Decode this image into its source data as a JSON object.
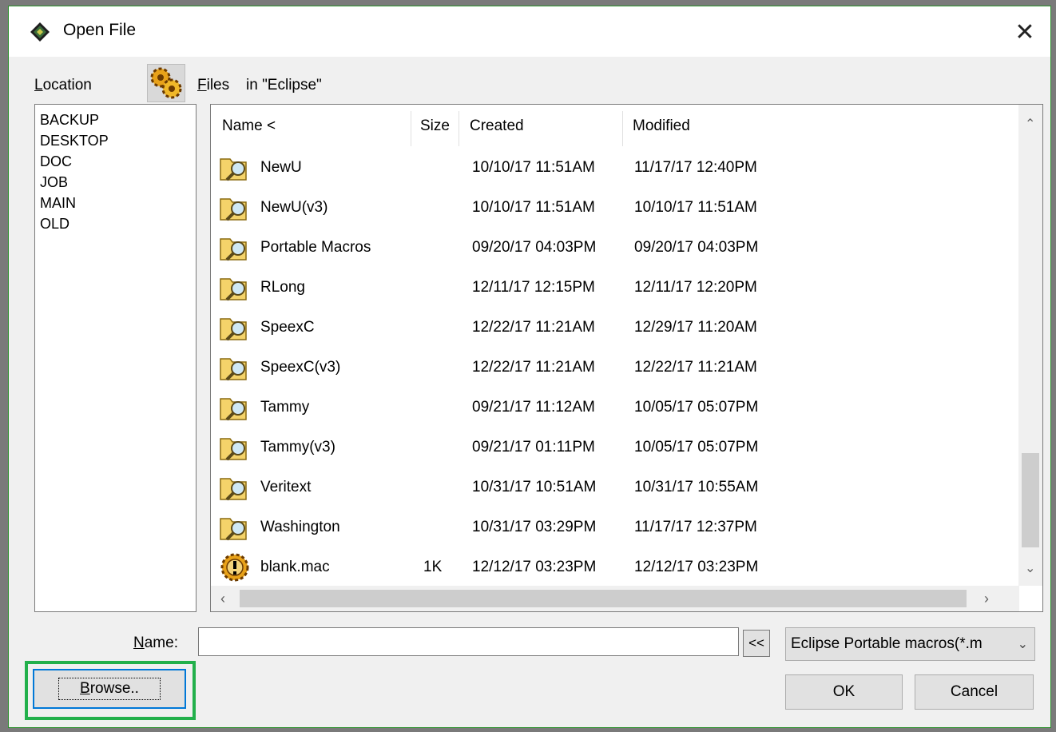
{
  "dialog": {
    "title": "Open File",
    "close_glyph": "✕"
  },
  "location": {
    "label": "Location",
    "items": [
      "BACKUP",
      "DESKTOP",
      "DOC",
      "JOB",
      "MAIN",
      "OLD"
    ]
  },
  "files": {
    "label": "Files",
    "context": "in \"Eclipse\"",
    "columns": [
      "Name <",
      "Size",
      "Created",
      "Modified"
    ],
    "rows": [
      {
        "name": "NewU",
        "size": "",
        "created": "10/10/17 11:51AM",
        "modified": "11/17/17 12:40PM",
        "icon": "folder-search-icon"
      },
      {
        "name": "NewU(v3)",
        "size": "",
        "created": "10/10/17 11:51AM",
        "modified": "10/10/17 11:51AM",
        "icon": "folder-search-icon"
      },
      {
        "name": "Portable Macros",
        "size": "",
        "created": "09/20/17 04:03PM",
        "modified": "09/20/17 04:03PM",
        "icon": "folder-search-icon"
      },
      {
        "name": "RLong",
        "size": "",
        "created": "12/11/17 12:15PM",
        "modified": "12/11/17 12:20PM",
        "icon": "folder-search-icon"
      },
      {
        "name": "SpeexC",
        "size": "",
        "created": "12/22/17 11:21AM",
        "modified": "12/29/17 11:20AM",
        "icon": "folder-search-icon"
      },
      {
        "name": "SpeexC(v3)",
        "size": "",
        "created": "12/22/17 11:21AM",
        "modified": "12/22/17 11:21AM",
        "icon": "folder-search-icon"
      },
      {
        "name": "Tammy",
        "size": "",
        "created": "09/21/17 11:12AM",
        "modified": "10/05/17 05:07PM",
        "icon": "folder-search-icon"
      },
      {
        "name": "Tammy(v3)",
        "size": "",
        "created": "09/21/17 01:11PM",
        "modified": "10/05/17 05:07PM",
        "icon": "folder-search-icon"
      },
      {
        "name": "Veritext",
        "size": "",
        "created": "10/31/17 10:51AM",
        "modified": "10/31/17 10:55AM",
        "icon": "folder-search-icon"
      },
      {
        "name": "Washington",
        "size": "",
        "created": "10/31/17 03:29PM",
        "modified": "11/17/17 12:37PM",
        "icon": "folder-search-icon"
      },
      {
        "name": "blank.mac",
        "size": "1K",
        "created": "12/12/17 03:23PM",
        "modified": "12/12/17 03:23PM",
        "icon": "macro-file-icon"
      }
    ]
  },
  "name_field": {
    "label": "Name:",
    "value": ""
  },
  "toggle_label": "<<",
  "filter": {
    "selected": "Eclipse Portable macros(*.m"
  },
  "buttons": {
    "browse": "Browse..",
    "ok": "OK",
    "cancel": "Cancel"
  },
  "icons": {
    "app": "app-diamond-icon",
    "files_toolbar": "gear-folder-icon",
    "scroll_up": "chevron-up-icon",
    "scroll_down": "chevron-down-icon",
    "scroll_left": "chevron-left-icon",
    "scroll_right": "chevron-right-icon",
    "dropdown": "chevron-down-icon"
  },
  "colors": {
    "accent_highlight": "#22b04b",
    "focus": "#0078d7"
  }
}
